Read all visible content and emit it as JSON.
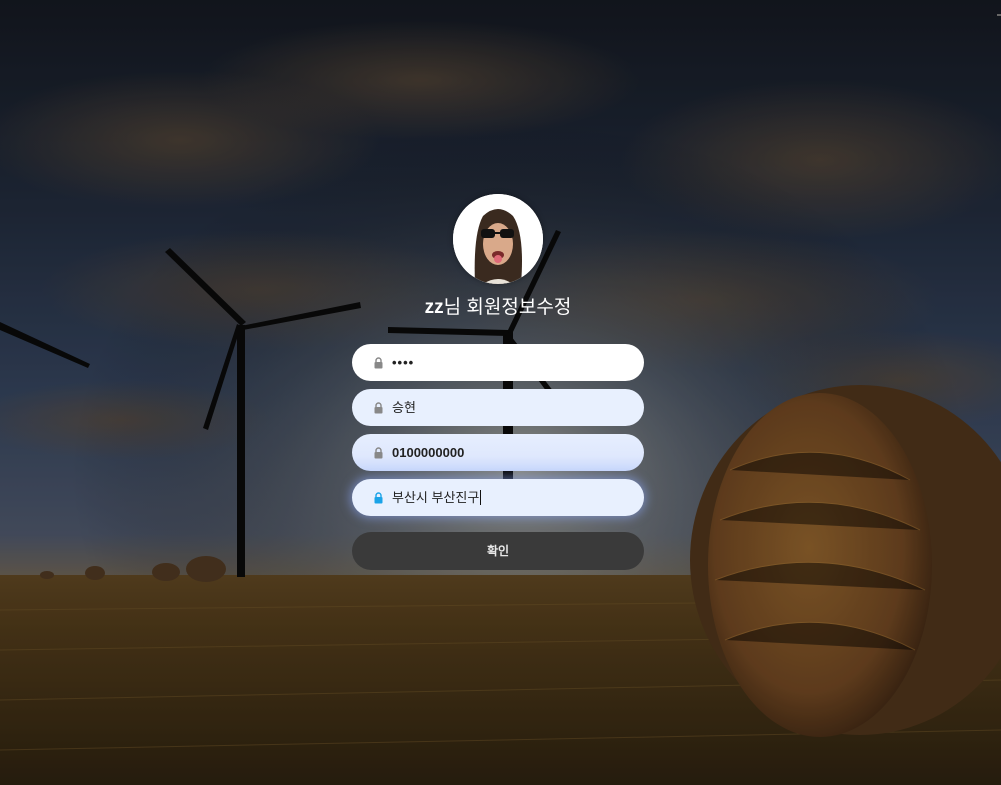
{
  "page": {
    "username": "zz",
    "title_suffix": "님 회원정보수정"
  },
  "form": {
    "password_value": "••••",
    "name_value": "승현",
    "phone_value": "0100000000",
    "address_value": "부산시 부산진구",
    "confirm_label": "확인"
  },
  "icons": {
    "lock": "lock-icon",
    "avatar": "profile-photo"
  },
  "colors": {
    "field_bg": "#e8f0fe",
    "button_bg": "#3a3a3a",
    "focus_lock": "#1aa3e8",
    "idle_lock": "#888888"
  }
}
